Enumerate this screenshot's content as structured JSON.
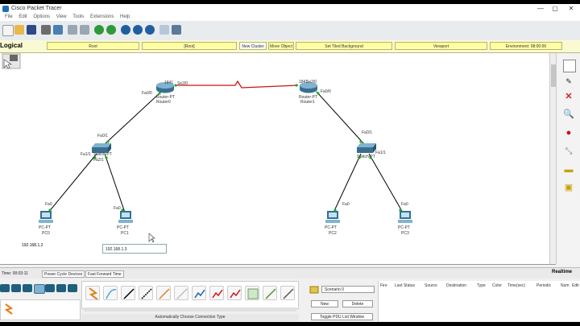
{
  "window": {
    "title": "Cisco Packet Tracer",
    "min_label": "—",
    "max_label": "▢",
    "close_label": "✕"
  },
  "menu": [
    "File",
    "Edit",
    "Options",
    "View",
    "Tools",
    "Extensions",
    "Help"
  ],
  "logical_bar": {
    "label": "Logical",
    "buttons": [
      "Root",
      "[Root]",
      "New Cluster",
      "Move Object",
      "Set Tiled Background",
      "Viewport",
      "Environment: 08:00:00"
    ]
  },
  "devices": {
    "router0": {
      "model": "1841",
      "name": "Router-PT",
      "hostname": "Router0",
      "ports": [
        "Fa0/0",
        "Se2/0",
        "Fa0/1"
      ]
    },
    "router1": {
      "model": "1841",
      "name": "Router-PT",
      "hostname": "Router1",
      "ports": [
        "Se2/0",
        "Fa0/0"
      ]
    },
    "switch0": {
      "name": "Switch-PT",
      "hostname": "Switch0",
      "ports": [
        "Fa0/1",
        "Fa1/1",
        "Fa2/1"
      ]
    },
    "switch1": {
      "name": "Switch-PT",
      "hostname": "Switch1",
      "ports": [
        "Fa0/1",
        "Fa1/1"
      ]
    },
    "pc0": {
      "name": "PC-PT",
      "hostname": "PC0",
      "port": "Fa0"
    },
    "pc1": {
      "name": "PC-PT",
      "hostname": "PC1",
      "port": "Fa0"
    },
    "pc2": {
      "name": "PC-PT",
      "hostname": "PC2",
      "port": "Fa0"
    },
    "pc3": {
      "name": "PC-PT",
      "hostname": "PC3",
      "port": "Fa0"
    }
  },
  "notes": {
    "pc0_ip": "192.168.1.2",
    "edit_box": "192.168.1.3"
  },
  "bottom_strip": {
    "time": "Time: 00:03:11",
    "power_cycle": "Power Cycle Devices",
    "fast_forward": "Fast Forward Time"
  },
  "connections": {
    "label": "Automatically Choose Connection Type"
  },
  "simulation": {
    "scenario": "Scenario 0",
    "new": "New",
    "delete": "Delete",
    "toggle": "Toggle PDU List Window",
    "realtime": "Realtime"
  },
  "pdu_columns": [
    "Fire",
    "Last Status",
    "Source",
    "Destination",
    "Type",
    "Color",
    "Time(sec)",
    "Periodic",
    "Num",
    "Edit"
  ],
  "colors": {
    "link_serial": "#cc1111",
    "link_copper": "#000000",
    "port_up": "#19b319",
    "toolbar_bg": "#e9ecef",
    "logical_bg": "#fafad2"
  }
}
